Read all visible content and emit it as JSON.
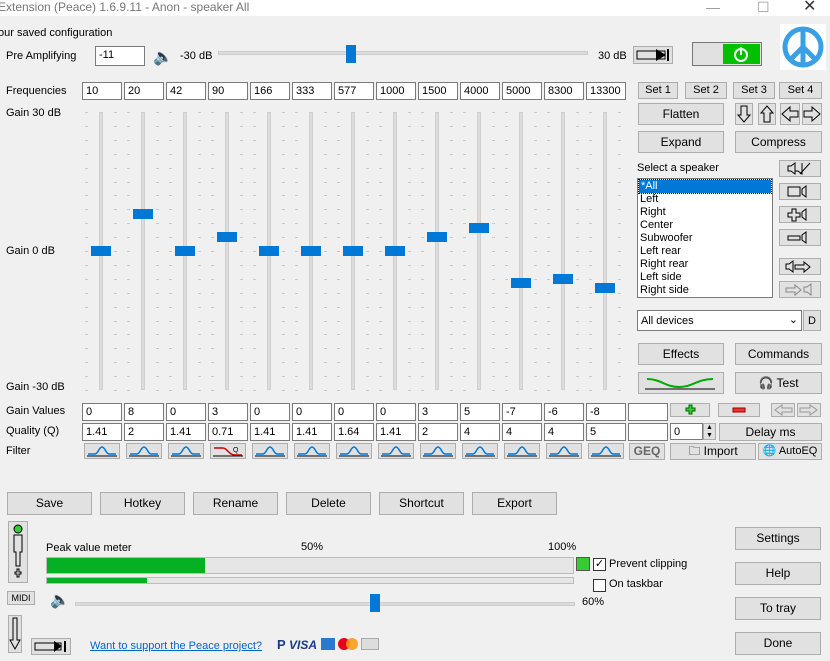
{
  "window": {
    "title": "Extension (Peace) 1.6.9.11 - Anon - speaker All"
  },
  "config_label": "our saved configuration",
  "preamp": {
    "label": "Pre Amplifying",
    "value": "-11",
    "min_label": "-30 dB",
    "max_label": "30 dB",
    "level": 0.36
  },
  "freq": {
    "label": "Frequencies",
    "values": [
      "10",
      "20",
      "42",
      "90",
      "166",
      "333",
      "577",
      "1000",
      "1500",
      "4000",
      "5000",
      "8300",
      "13300"
    ]
  },
  "gain": {
    "top": "Gain 30 dB",
    "mid": "Gain 0 dB",
    "bottom": "Gain -30 dB",
    "values_label": "Gain Values",
    "values": [
      "0",
      "8",
      "0",
      "3",
      "0",
      "0",
      "0",
      "0",
      "3",
      "5",
      "-7",
      "-6",
      "-8",
      ""
    ],
    "levels_db": [
      0,
      8,
      0,
      3,
      0,
      0,
      0,
      0,
      3,
      5,
      -7,
      -6,
      -8
    ]
  },
  "quality": {
    "label": "Quality (Q)",
    "values": [
      "1.41",
      "2",
      "1.41",
      "0.71",
      "1.41",
      "1.41",
      "1.64",
      "1.41",
      "2",
      "4",
      "4",
      "4",
      "5",
      ""
    ]
  },
  "filter": {
    "label": "Filter"
  },
  "sets": {
    "s1": "Set 1",
    "s2": "Set 2",
    "s3": "Set 3",
    "s4": "Set 4"
  },
  "actions": {
    "flatten": "Flatten",
    "expand": "Expand",
    "compress": "Compress"
  },
  "speaker": {
    "label": "Select a speaker",
    "items": [
      "*All",
      "Left",
      "Right",
      "Center",
      "Subwoofer",
      "Left rear",
      "Right rear",
      "Left side",
      "Right side"
    ]
  },
  "device": {
    "selected": "All devices",
    "d_button": "D"
  },
  "effects": "Effects",
  "commands": "Commands",
  "test": "Test",
  "delay": {
    "value": "0",
    "label": "Delay ms"
  },
  "geq": "GEQ",
  "import": "Import",
  "autoeq": "AutoEQ",
  "bottom_buttons": {
    "save": "Save",
    "hotkey": "Hotkey",
    "rename": "Rename",
    "delete": "Delete",
    "shortcut": "Shortcut",
    "export": "Export"
  },
  "meter": {
    "label": "Peak value meter",
    "mid": "50%",
    "max": "100%",
    "peak_fill": 0.3,
    "level_fill": 0.19,
    "prevent_clipping": "Prevent clipping",
    "on_taskbar": "On taskbar"
  },
  "midi": "MIDI",
  "volume": {
    "value_label": "60%",
    "level": 0.6
  },
  "side": {
    "settings": "Settings",
    "help": "Help",
    "to_tray": "To tray",
    "done": "Done"
  },
  "support_link": "Want to support the Peace project?",
  "payment_text": "VISA",
  "colors": {
    "accent": "#0078d7",
    "power_green": "#00c000",
    "meter_green": "#06b025",
    "logo_blue": "#3aa0e6"
  }
}
